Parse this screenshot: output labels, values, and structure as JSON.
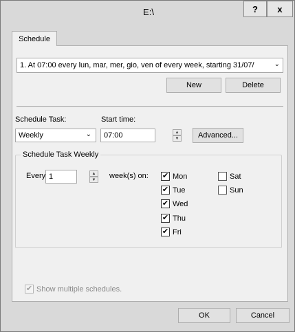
{
  "window": {
    "title": "E:\\",
    "help_glyph": "?",
    "close_glyph": "x"
  },
  "tabs": [
    {
      "label": "Schedule"
    }
  ],
  "schedule_list": {
    "selected": "1. At 07:00 every lun, mar, mer, gio, ven of every week, starting 31/07/"
  },
  "buttons": {
    "new": "New",
    "delete": "Delete",
    "advanced": "Advanced...",
    "ok": "OK",
    "cancel": "Cancel"
  },
  "schedule_task": {
    "label": "Schedule Task:",
    "value": "Weekly"
  },
  "start_time": {
    "label": "Start time:",
    "value": "07:00"
  },
  "weekly_group": {
    "title": "Schedule Task Weekly",
    "every_label": "Every",
    "every_value": "1",
    "weeks_on_label": "week(s) on:"
  },
  "days": [
    {
      "label": "Mon",
      "checked": true
    },
    {
      "label": "Tue",
      "checked": true
    },
    {
      "label": "Wed",
      "checked": true
    },
    {
      "label": "Thu",
      "checked": true
    },
    {
      "label": "Fri",
      "checked": true
    },
    {
      "label": "Sat",
      "checked": false
    },
    {
      "label": "Sun",
      "checked": false
    }
  ],
  "show_multiple": {
    "label": "Show multiple schedules.",
    "checked": true
  }
}
